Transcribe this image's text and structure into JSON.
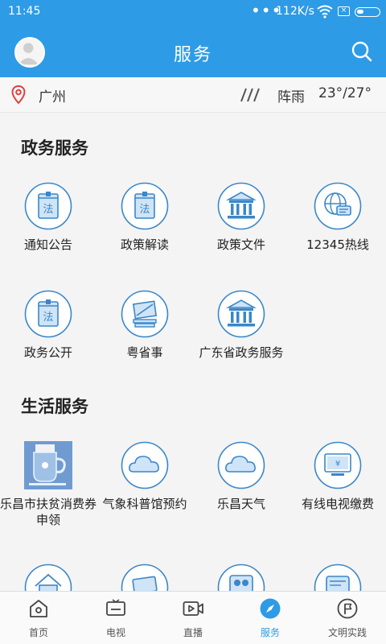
{
  "status_bar": {
    "time": "11:45",
    "network_speed": "112K/s",
    "dots": "•••",
    "sim_label": "×"
  },
  "header": {
    "title": "服务",
    "avatar_icon": "user-avatar-icon",
    "search_icon": "search-icon"
  },
  "weather": {
    "city": "广州",
    "condition": "阵雨",
    "temperature": "23°/27°",
    "location_icon": "location-pin-icon",
    "rain_icon": "rain-icon"
  },
  "sections": {
    "government": {
      "title": "政务服务",
      "items": [
        {
          "label": "通知公告",
          "icon": "law-book-icon"
        },
        {
          "label": "政策解读",
          "icon": "law-book-icon"
        },
        {
          "label": "政策文件",
          "icon": "government-building-icon"
        },
        {
          "label": "12345热线",
          "icon": "globe-chat-icon"
        },
        {
          "label": "政务公开",
          "icon": "law-book-icon"
        },
        {
          "label": "粤省事",
          "icon": "tools-icon"
        },
        {
          "label": "广东省政务服务",
          "icon": "government-building-icon"
        }
      ]
    },
    "life": {
      "title": "生活服务",
      "items": [
        {
          "label": "乐昌市扶贫消费券申领",
          "icon": "poverty-coupon-image"
        },
        {
          "label": "气象科普馆预约",
          "icon": "cloud-icon"
        },
        {
          "label": "乐昌天气",
          "icon": "cloud-icon"
        },
        {
          "label": "有线电视缴费",
          "icon": "tv-payment-icon"
        }
      ]
    }
  },
  "bottom_nav": [
    {
      "label": "首页",
      "icon": "home-icon",
      "active": false
    },
    {
      "label": "电视",
      "icon": "tv-icon",
      "active": false
    },
    {
      "label": "直播",
      "icon": "live-video-icon",
      "active": false
    },
    {
      "label": "服务",
      "icon": "compass-icon",
      "active": true
    },
    {
      "label": "文明实践",
      "icon": "flag-icon",
      "active": false
    }
  ],
  "colors": {
    "primary": "#2e9be6",
    "icon_stroke": "#3a87c9",
    "icon_fill": "#cfe4f7"
  }
}
